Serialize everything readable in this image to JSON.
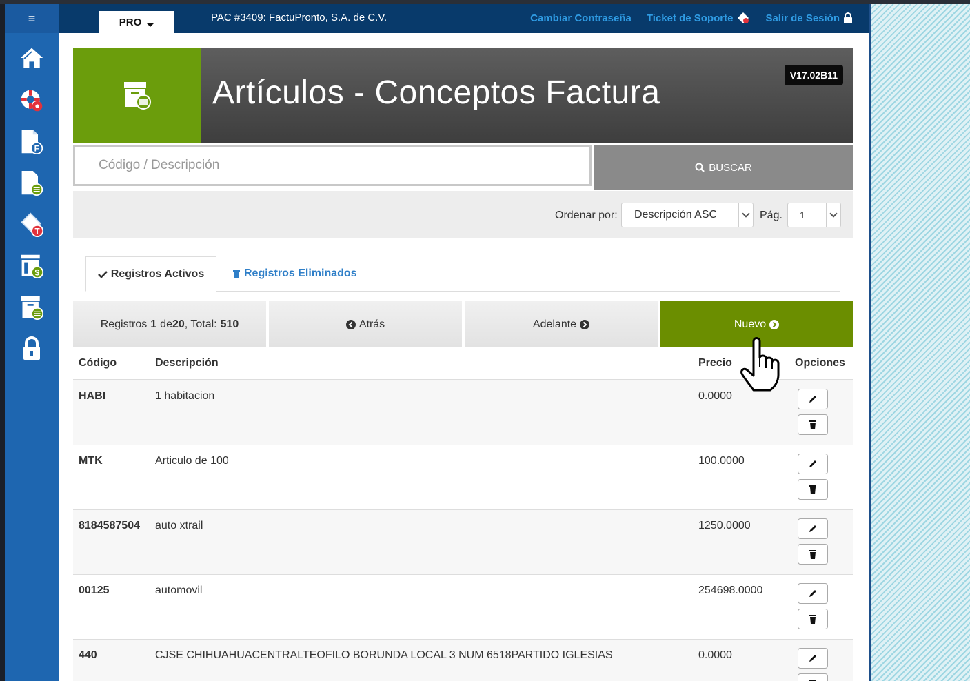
{
  "topbar": {
    "menu_glyph": "≡",
    "plan_label": "PRO",
    "pac_text": "PAC #3409: FactuPronto, S.A. de C.V.",
    "links": {
      "change_password": "Cambiar Contraseña",
      "support_ticket": "Ticket de Soporte",
      "logout": "Salir de Sesión"
    }
  },
  "header": {
    "title": "Artículos - Conceptos Factura",
    "version": "V17.02B11"
  },
  "search": {
    "placeholder": "Código / Descripción",
    "button_label": "BUSCAR"
  },
  "sort": {
    "label": "Ordenar por:",
    "selected": "Descripción ASC",
    "page_label": "Pág.",
    "page_value": "1"
  },
  "tabs": {
    "active": "Registros Activos",
    "deleted": "Registros Eliminados"
  },
  "nav": {
    "records_prefix": "Registros",
    "records_from": "1",
    "records_of": "de",
    "records_to": "20",
    "total_label": ", Total:",
    "total": "510",
    "back": "Atrás",
    "forward": "Adelante",
    "new": "Nuevo"
  },
  "table": {
    "headers": {
      "code": "Código",
      "description": "Descripción",
      "price": "Precio",
      "options": "Opciones"
    },
    "rows": [
      {
        "code": "HABI",
        "description": "1 habitacion",
        "price": "0.0000"
      },
      {
        "code": "MTK",
        "description": "Articulo de 100",
        "price": "100.0000"
      },
      {
        "code": "8184587504",
        "description": "auto xtrail",
        "price": "1250.0000"
      },
      {
        "code": "00125",
        "description": "automovil",
        "price": "254698.0000"
      },
      {
        "code": "440",
        "description": "CJSE CHIHUAHUACENTRALTEOFILO BORUNDA LOCAL 3 NUM 6518PARTIDO IGLESIAS",
        "price": "0.0000"
      }
    ]
  },
  "colors": {
    "sidebar": "#1e66b0",
    "topbar": "#083a6b",
    "accent_green": "#6b9d0c",
    "link_blue": "#2f9be3"
  }
}
